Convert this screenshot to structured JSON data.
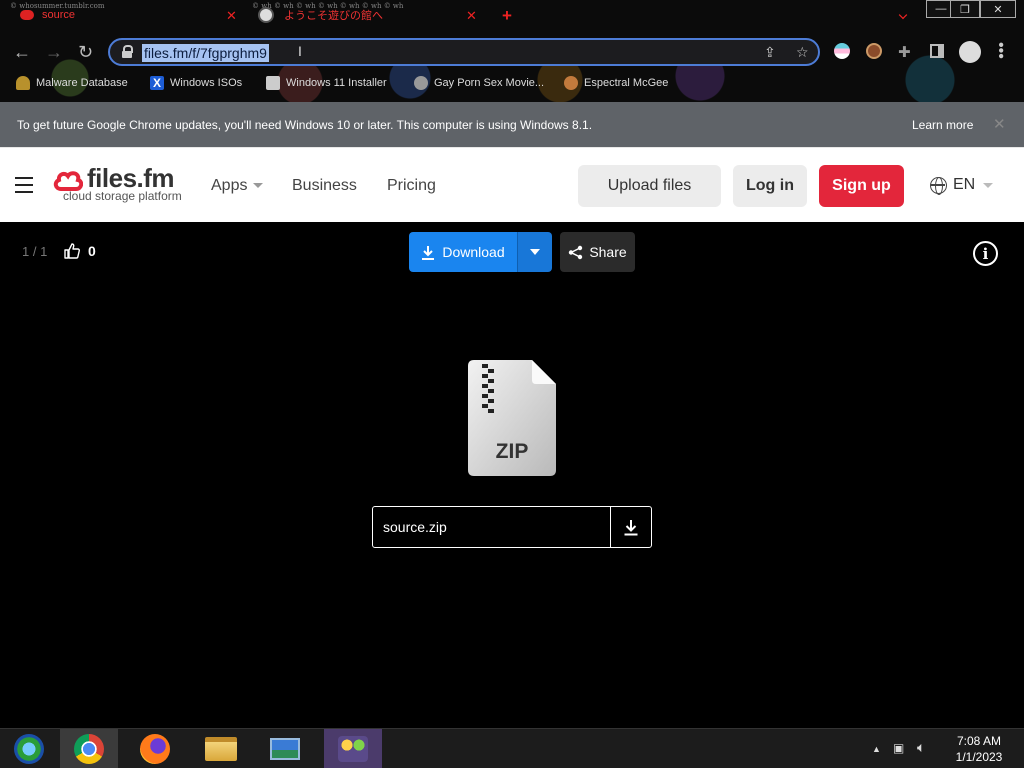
{
  "browser": {
    "tabs": [
      {
        "tiny": "© whosummer.tumblr.com",
        "label": "source",
        "close": "✕"
      },
      {
        "tiny": "© wh  © wh  © wh  © wh  © wh  © wh  © wh",
        "label": "ようこそ遊びの館へ",
        "close": "✕"
      }
    ],
    "new_tab": "+",
    "window_controls": {
      "minimize": "—",
      "maximize": "❐",
      "close": "✕"
    },
    "url": "files.fm/f/7fgprghm9",
    "bookmarks": [
      {
        "label": "Malware Database",
        "color": "#b8912c"
      },
      {
        "label": "Windows ISOs",
        "color": "#1d5dd6"
      },
      {
        "label": "Windows 11 Installer",
        "color": "#cccccc"
      },
      {
        "label": "Gay Porn Sex Movie...",
        "color": "#999999"
      },
      {
        "label": "Espectral McGee",
        "color": "#c27a3c"
      }
    ]
  },
  "infobar": {
    "text": "To get future Google Chrome updates, you'll need Windows 10 or later. This computer is using Windows 8.1.",
    "link": "Learn more",
    "close": "✕"
  },
  "site": {
    "logo_name": "files.fm",
    "logo_tagline": "cloud storage platform",
    "nav": {
      "apps": "Apps",
      "business": "Business",
      "pricing": "Pricing"
    },
    "buttons": {
      "upload": "Upload files",
      "login": "Log in",
      "signup": "Sign up"
    },
    "language": "EN",
    "colors": {
      "brand_red": "#e3263b",
      "download_blue": "#1a85ef"
    }
  },
  "viewer": {
    "counter": "1 / 1",
    "likes": "0",
    "download_label": "Download",
    "share_label": "Share",
    "info": "i",
    "file_type": "ZIP",
    "file_name": "source.zip"
  },
  "taskbar": {
    "apps": [
      "windows-media-center",
      "chrome",
      "firefox",
      "file-explorer",
      "photo-viewer",
      "remote-app"
    ],
    "time": "7:08 AM",
    "date": "1/1/2023",
    "tray_arrow": "▲"
  }
}
